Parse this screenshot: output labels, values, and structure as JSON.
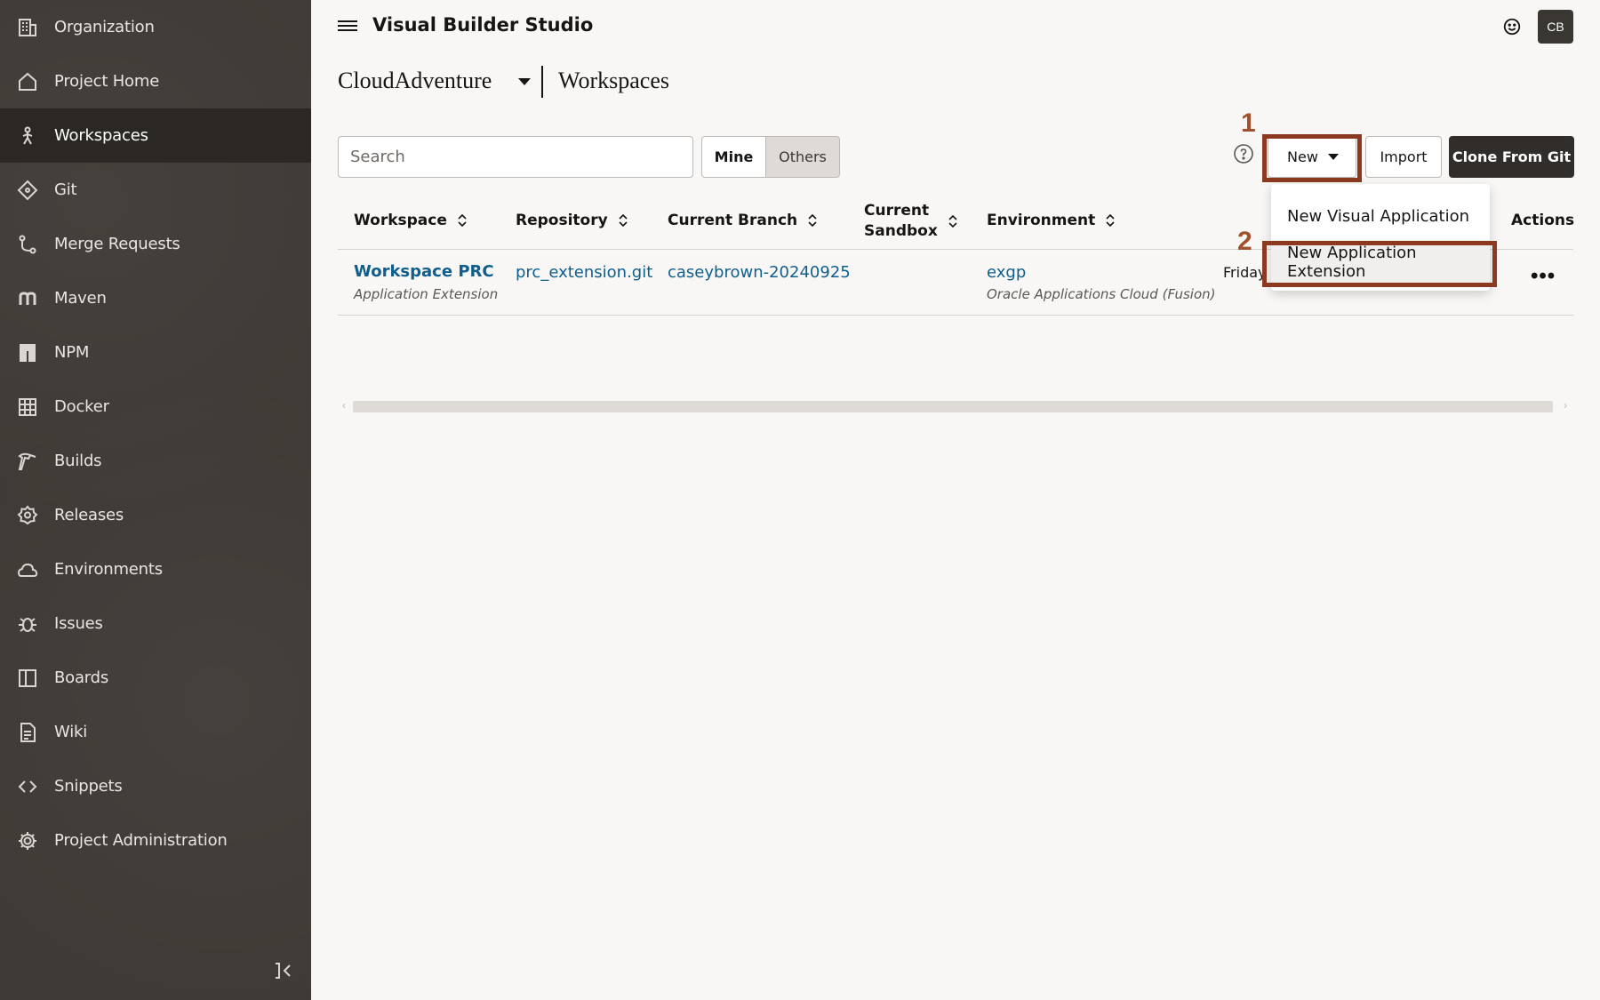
{
  "sidebar": {
    "items": [
      {
        "label": "Organization",
        "icon": "building-icon"
      },
      {
        "label": "Project Home",
        "icon": "home-icon"
      },
      {
        "label": "Workspaces",
        "icon": "workspace-icon",
        "active": true
      },
      {
        "label": "Git",
        "icon": "git-icon"
      },
      {
        "label": "Merge Requests",
        "icon": "merge-icon"
      },
      {
        "label": "Maven",
        "icon": "maven-icon"
      },
      {
        "label": "NPM",
        "icon": "npm-icon"
      },
      {
        "label": "Docker",
        "icon": "docker-icon"
      },
      {
        "label": "Builds",
        "icon": "hammer-icon"
      },
      {
        "label": "Releases",
        "icon": "badge-icon"
      },
      {
        "label": "Environments",
        "icon": "cloud-icon"
      },
      {
        "label": "Issues",
        "icon": "bug-icon"
      },
      {
        "label": "Boards",
        "icon": "board-icon"
      },
      {
        "label": "Wiki",
        "icon": "document-icon"
      },
      {
        "label": "Snippets",
        "icon": "code-icon"
      },
      {
        "label": "Project Administration",
        "icon": "gear-icon"
      }
    ]
  },
  "header": {
    "app_title": "Visual Builder Studio",
    "avatar_initials": "CB",
    "project_name": "CloudAdventure",
    "page_title": "Workspaces"
  },
  "toolbar": {
    "search_placeholder": "Search",
    "toggle_mine": "Mine",
    "toggle_others": "Others",
    "new_label": "New",
    "import_label": "Import",
    "clone_label": "Clone From Git",
    "step1": "1",
    "step2": "2"
  },
  "table": {
    "columns": {
      "workspace": "Workspace",
      "repository": "Repository",
      "branch": "Current Branch",
      "sandbox_line1": "Current",
      "sandbox_line2": "Sandbox",
      "environment": "Environment",
      "actions": "Actions"
    },
    "rows": [
      {
        "workspace": "Workspace PRC",
        "workspace_type": "Application Extension",
        "repository": "prc_extension.git",
        "branch": "caseybrown-20240925",
        "environment": "exgp",
        "environment_type": "Oracle Applications Cloud (Fusion)",
        "updated": "Friday"
      }
    ]
  },
  "menu": {
    "items": [
      "New Visual Application",
      "New Application Extension"
    ]
  },
  "colors": {
    "sidebar_bg": "#3f3a35",
    "link": "#0f5e8c",
    "highlight": "#8b3a1f",
    "primary_button": "#312d2a"
  }
}
